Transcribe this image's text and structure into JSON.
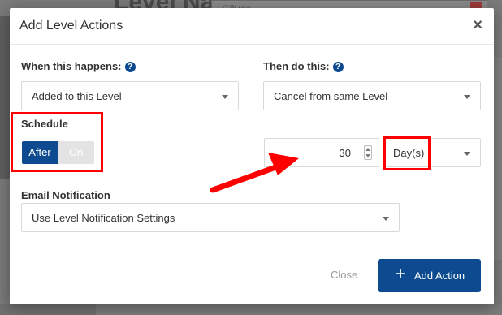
{
  "background": {
    "page_title": "Level Name",
    "name_value": "Silver"
  },
  "modal": {
    "title": "Add Level Actions",
    "close_glyph": "×",
    "when_label": "When this happens:",
    "when_value": "Added to this Level",
    "then_label": "Then do this:",
    "then_value": "Cancel from same Level",
    "schedule_label": "Schedule",
    "toggle_after": "After",
    "toggle_on": "On",
    "schedule_amount": "30",
    "schedule_unit": "Day(s)",
    "email_label": "Email Notification",
    "email_value": "Use Level Notification Settings",
    "help_glyph": "?",
    "close_button": "Close",
    "add_button_icon": "+",
    "add_button": "Add Action"
  },
  "colors": {
    "primary": "#0d4a8f",
    "annotation": "#ff0000"
  },
  "icons": {
    "help": "help-icon",
    "close": "close-icon",
    "plus": "plus-icon",
    "caret": "caret-down-icon"
  }
}
